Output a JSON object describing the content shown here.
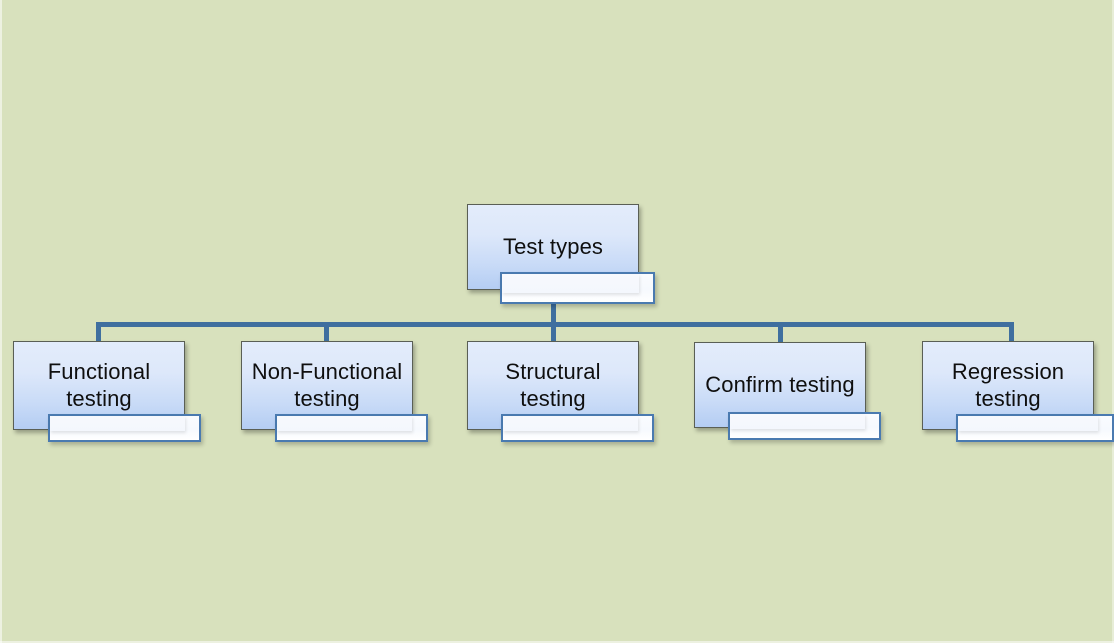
{
  "diagram": {
    "title": "Test types hierarchy",
    "background_color": "#d8e1bd",
    "connector_color": "#3f6f9f",
    "node_border_color": "#5a5f55",
    "node_fill_top": "#e3ecfb",
    "node_fill_bottom": "#b4cdf3",
    "subbox_border_color": "#4a7ab0",
    "subbox_fill": "#fafcff",
    "text_color": "#0f0f0f",
    "root": {
      "label": "Test types"
    },
    "children": [
      {
        "label": "Functional\ntesting"
      },
      {
        "label": "Non-Functional\ntesting"
      },
      {
        "label": "Structural\ntesting"
      },
      {
        "label": "Confirm testing"
      },
      {
        "label": "Regression\ntesting"
      }
    ],
    "subboxes": [
      {
        "label": ""
      },
      {
        "label": ""
      },
      {
        "label": ""
      },
      {
        "label": ""
      },
      {
        "label": ""
      },
      {
        "label": ""
      }
    ]
  }
}
